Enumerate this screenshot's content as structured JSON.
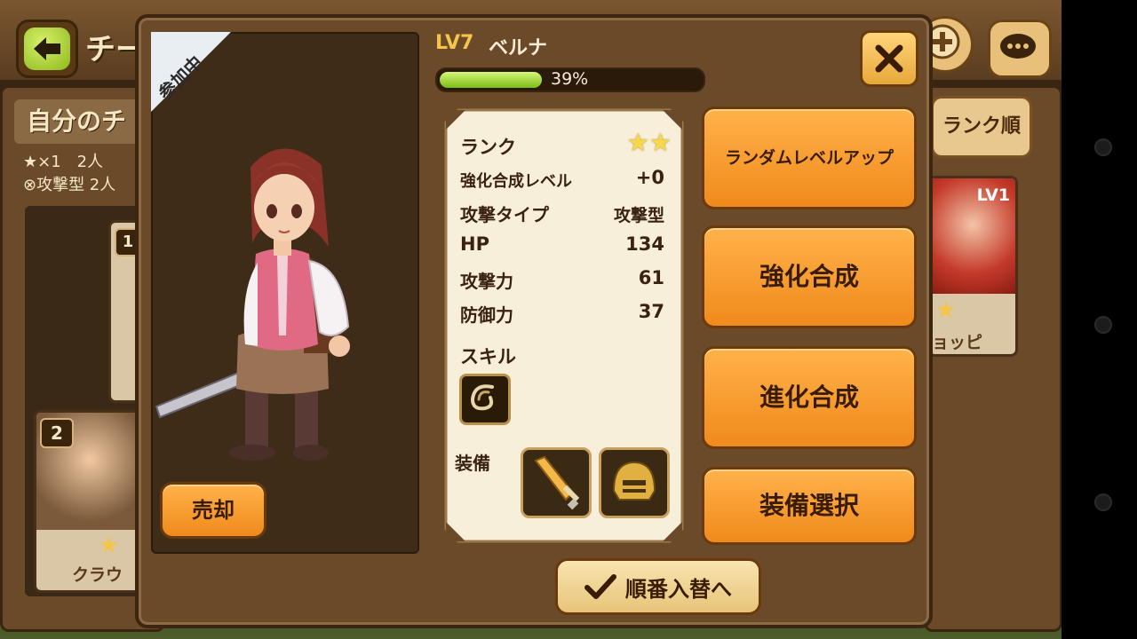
{
  "background": {
    "title_fragment": "チー",
    "left_panel": {
      "title": "自分のチ",
      "line1": "★×1　2人",
      "line2": "⊗攻撃型 2人",
      "cards": [
        {
          "slot": "1"
        },
        {
          "slot": "2",
          "name": "クラウ"
        }
      ]
    },
    "right_panel": {
      "sort_button": "ランク順",
      "card": {
        "level": "LV1",
        "name": "ョッピ"
      }
    }
  },
  "dialog": {
    "status_ribbon": "参加中",
    "level": "LV7",
    "name": "ベルナ",
    "exp_percent": 39,
    "exp_text": "39%",
    "sell_button": "売却",
    "stats": {
      "rank_label": "ランク",
      "rank_stars": 2,
      "rows": [
        {
          "label": "強化合成レベル",
          "value": "+0"
        },
        {
          "label": "攻撃タイプ",
          "value": "攻撃型"
        },
        {
          "label": "HP",
          "value": "134"
        },
        {
          "label": "攻撃力",
          "value": "61"
        },
        {
          "label": "防御力",
          "value": "37"
        }
      ],
      "skill_label": "スキル",
      "equip_label": "装備"
    },
    "side_buttons": {
      "random_level_up": "ランダムレベルアップ",
      "enhance": "強化合成",
      "evolve": "進化合成",
      "equip_select": "装備選択"
    },
    "reorder_button": "順番入替へ"
  },
  "colors": {
    "accent_orange": "#f08a1c",
    "exp_green": "#7cbc14",
    "level_gold": "#f3c54a",
    "panel_brown": "#6b4a2a",
    "parchment": "#f7efd9"
  }
}
